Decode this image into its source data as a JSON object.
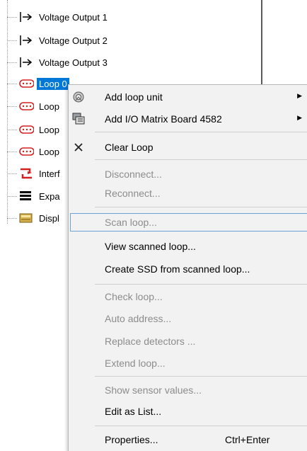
{
  "tree": {
    "items": [
      {
        "label": "Voltage Output 1",
        "icon": "arrow-output-icon"
      },
      {
        "label": "Voltage Output 2",
        "icon": "arrow-output-icon"
      },
      {
        "label": "Voltage Output 3",
        "icon": "arrow-output-icon"
      },
      {
        "label": "Loop 0",
        "icon": "loop-icon",
        "selected": true
      },
      {
        "label": "Loop",
        "icon": "loop-icon"
      },
      {
        "label": "Loop",
        "icon": "loop-icon"
      },
      {
        "label": "Loop",
        "icon": "loop-icon"
      },
      {
        "label": "Interf",
        "icon": "interface-icon"
      },
      {
        "label": "Expa",
        "icon": "expansion-icon"
      },
      {
        "label": "Displ",
        "icon": "display-icon"
      }
    ]
  },
  "menu": {
    "items": [
      {
        "label": "Add loop unit",
        "icon": "detector-icon",
        "submenu": true,
        "disabled": false
      },
      {
        "label": "Add I/O Matrix Board 4582",
        "icon": "board-icon",
        "submenu": true,
        "disabled": false
      },
      {
        "label": "Clear Loop",
        "icon": "clear-x-icon",
        "disabled": false
      },
      {
        "label": "Disconnect...",
        "disabled": true
      },
      {
        "label": "Reconnect...",
        "disabled": true
      },
      {
        "label": "Scan loop...",
        "disabled": true,
        "highlighted": true
      },
      {
        "label": "View scanned loop...",
        "disabled": false
      },
      {
        "label": "Create SSD from scanned loop...",
        "disabled": false
      },
      {
        "label": "Check loop...",
        "disabled": true
      },
      {
        "label": "Auto address...",
        "disabled": true
      },
      {
        "label": "Replace detectors ...",
        "disabled": true
      },
      {
        "label": "Extend loop...",
        "disabled": true
      },
      {
        "label": "Show sensor values...",
        "disabled": true
      },
      {
        "label": "Edit as List...",
        "disabled": false
      },
      {
        "label": "Properties...",
        "shortcut": "Ctrl+Enter",
        "disabled": false
      }
    ]
  },
  "colors": {
    "selection": "#0078d7",
    "loop_icon": "#d42020",
    "disabled_text": "#8c8c8c",
    "menu_bg": "#f2f2f2"
  }
}
